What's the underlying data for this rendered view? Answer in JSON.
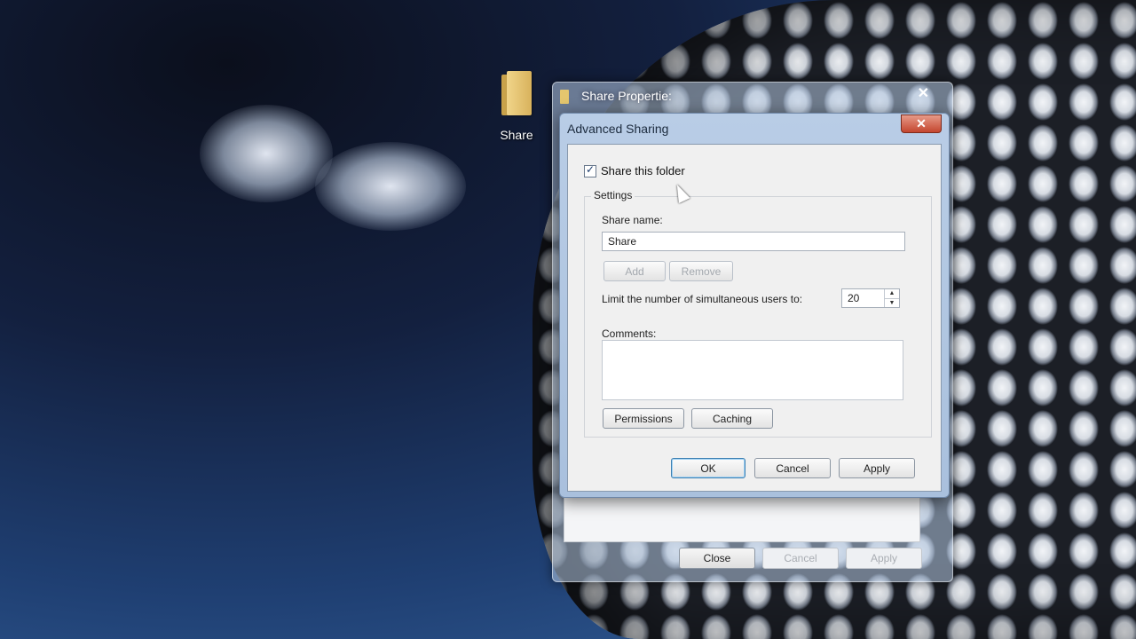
{
  "desktop": {
    "icon_label": "Share"
  },
  "back_window": {
    "title": "Share Propertie:",
    "buttons": {
      "close": "Close",
      "cancel": "Cancel",
      "apply": "Apply"
    }
  },
  "dialog": {
    "title": "Advanced Sharing",
    "share_checkbox": {
      "label": "Share this folder",
      "checked": true
    },
    "settings_legend": "Settings",
    "share_name_label": "Share name:",
    "share_name_value": "Share",
    "add_label": "Add",
    "remove_label": "Remove",
    "limit_label": "Limit the number of simultaneous users to:",
    "limit_value": "20",
    "comments_label": "Comments:",
    "comments_value": "",
    "permissions_label": "Permissions",
    "caching_label": "Caching",
    "ok_label": "OK",
    "cancel_label": "Cancel",
    "apply_label": "Apply"
  },
  "icons": {
    "folder": "folder-icon",
    "close": "close-icon",
    "checkbox": "checkmark-icon",
    "spin_up": "arrow-up-icon",
    "spin_down": "arrow-down-icon",
    "cursor": "mouse-cursor-icon"
  }
}
